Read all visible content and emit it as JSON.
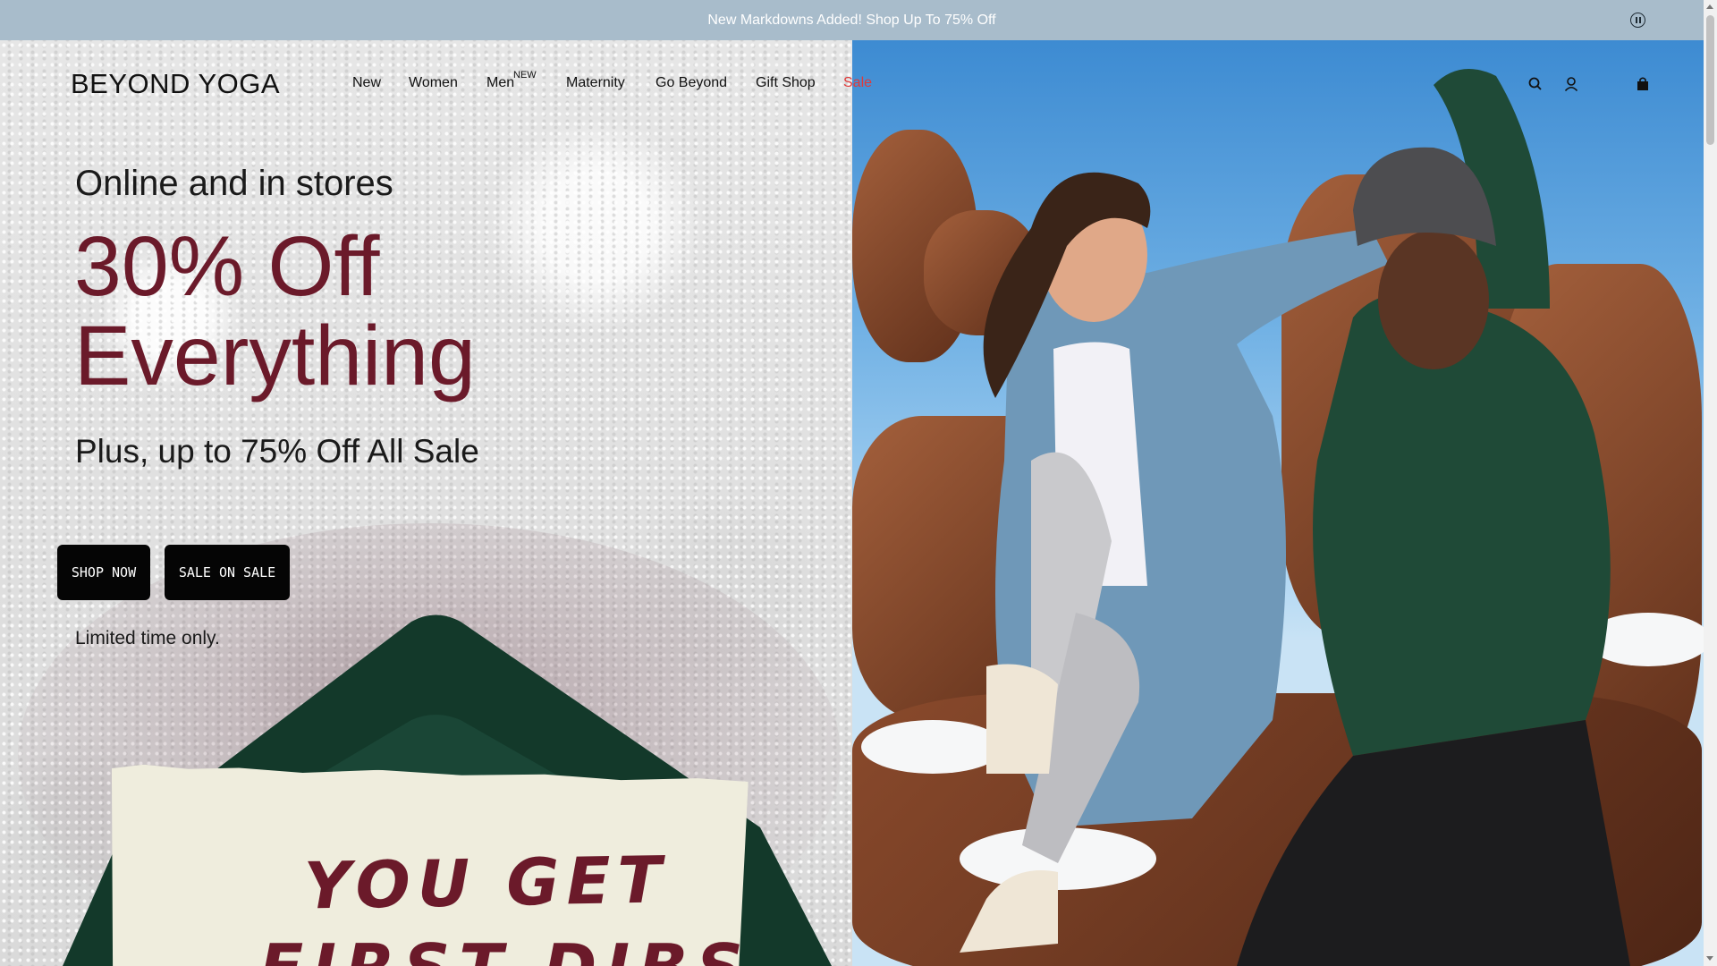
{
  "announcement": {
    "text": "New Markdowns Added! Shop Up To 75% Off",
    "pause_icon": "pause-circle-icon"
  },
  "header": {
    "logo": "BEYOND YOGA",
    "nav": [
      {
        "label": "New"
      },
      {
        "label": "Women"
      },
      {
        "label": "Men",
        "tag": "NEW"
      },
      {
        "label": "Maternity"
      },
      {
        "label": "Go Beyond"
      },
      {
        "label": "Gift Shop"
      },
      {
        "label": "Sale"
      }
    ],
    "icons": [
      "search-icon",
      "account-icon",
      "bag-icon"
    ],
    "sale_color": "#e03a3a"
  },
  "hero": {
    "kicker": "Online and in stores",
    "headline_line1": "30% Off",
    "headline_line2": "Everything",
    "subhead": "Plus, up to 75% Off All Sale",
    "buttons": {
      "shop_now": "SHOP NOW",
      "sale_on_sale": "SALE ON SALE"
    },
    "note": "Limited time only.",
    "card_line1": "YOU GET",
    "card_line2": "FIRST DIBS",
    "headline_color": "#6b1a2a"
  }
}
